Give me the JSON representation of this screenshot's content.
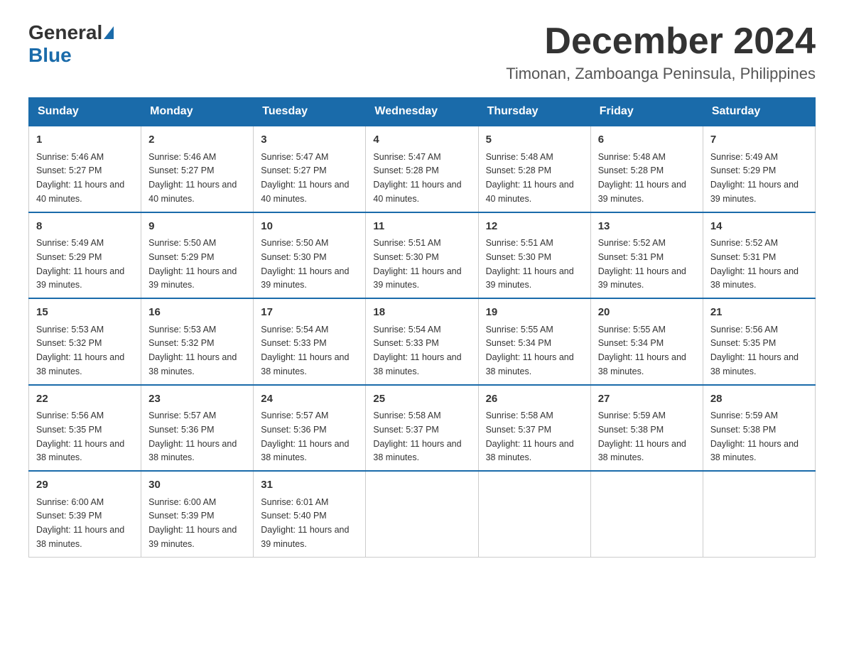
{
  "header": {
    "logo_general": "General",
    "logo_blue": "Blue",
    "month_title": "December 2024",
    "location": "Timonan, Zamboanga Peninsula, Philippines"
  },
  "days_of_week": [
    "Sunday",
    "Monday",
    "Tuesday",
    "Wednesday",
    "Thursday",
    "Friday",
    "Saturday"
  ],
  "weeks": [
    [
      {
        "day": "1",
        "sunrise": "5:46 AM",
        "sunset": "5:27 PM",
        "daylight": "11 hours and 40 minutes."
      },
      {
        "day": "2",
        "sunrise": "5:46 AM",
        "sunset": "5:27 PM",
        "daylight": "11 hours and 40 minutes."
      },
      {
        "day": "3",
        "sunrise": "5:47 AM",
        "sunset": "5:27 PM",
        "daylight": "11 hours and 40 minutes."
      },
      {
        "day": "4",
        "sunrise": "5:47 AM",
        "sunset": "5:28 PM",
        "daylight": "11 hours and 40 minutes."
      },
      {
        "day": "5",
        "sunrise": "5:48 AM",
        "sunset": "5:28 PM",
        "daylight": "11 hours and 40 minutes."
      },
      {
        "day": "6",
        "sunrise": "5:48 AM",
        "sunset": "5:28 PM",
        "daylight": "11 hours and 39 minutes."
      },
      {
        "day": "7",
        "sunrise": "5:49 AM",
        "sunset": "5:29 PM",
        "daylight": "11 hours and 39 minutes."
      }
    ],
    [
      {
        "day": "8",
        "sunrise": "5:49 AM",
        "sunset": "5:29 PM",
        "daylight": "11 hours and 39 minutes."
      },
      {
        "day": "9",
        "sunrise": "5:50 AM",
        "sunset": "5:29 PM",
        "daylight": "11 hours and 39 minutes."
      },
      {
        "day": "10",
        "sunrise": "5:50 AM",
        "sunset": "5:30 PM",
        "daylight": "11 hours and 39 minutes."
      },
      {
        "day": "11",
        "sunrise": "5:51 AM",
        "sunset": "5:30 PM",
        "daylight": "11 hours and 39 minutes."
      },
      {
        "day": "12",
        "sunrise": "5:51 AM",
        "sunset": "5:30 PM",
        "daylight": "11 hours and 39 minutes."
      },
      {
        "day": "13",
        "sunrise": "5:52 AM",
        "sunset": "5:31 PM",
        "daylight": "11 hours and 39 minutes."
      },
      {
        "day": "14",
        "sunrise": "5:52 AM",
        "sunset": "5:31 PM",
        "daylight": "11 hours and 38 minutes."
      }
    ],
    [
      {
        "day": "15",
        "sunrise": "5:53 AM",
        "sunset": "5:32 PM",
        "daylight": "11 hours and 38 minutes."
      },
      {
        "day": "16",
        "sunrise": "5:53 AM",
        "sunset": "5:32 PM",
        "daylight": "11 hours and 38 minutes."
      },
      {
        "day": "17",
        "sunrise": "5:54 AM",
        "sunset": "5:33 PM",
        "daylight": "11 hours and 38 minutes."
      },
      {
        "day": "18",
        "sunrise": "5:54 AM",
        "sunset": "5:33 PM",
        "daylight": "11 hours and 38 minutes."
      },
      {
        "day": "19",
        "sunrise": "5:55 AM",
        "sunset": "5:34 PM",
        "daylight": "11 hours and 38 minutes."
      },
      {
        "day": "20",
        "sunrise": "5:55 AM",
        "sunset": "5:34 PM",
        "daylight": "11 hours and 38 minutes."
      },
      {
        "day": "21",
        "sunrise": "5:56 AM",
        "sunset": "5:35 PM",
        "daylight": "11 hours and 38 minutes."
      }
    ],
    [
      {
        "day": "22",
        "sunrise": "5:56 AM",
        "sunset": "5:35 PM",
        "daylight": "11 hours and 38 minutes."
      },
      {
        "day": "23",
        "sunrise": "5:57 AM",
        "sunset": "5:36 PM",
        "daylight": "11 hours and 38 minutes."
      },
      {
        "day": "24",
        "sunrise": "5:57 AM",
        "sunset": "5:36 PM",
        "daylight": "11 hours and 38 minutes."
      },
      {
        "day": "25",
        "sunrise": "5:58 AM",
        "sunset": "5:37 PM",
        "daylight": "11 hours and 38 minutes."
      },
      {
        "day": "26",
        "sunrise": "5:58 AM",
        "sunset": "5:37 PM",
        "daylight": "11 hours and 38 minutes."
      },
      {
        "day": "27",
        "sunrise": "5:59 AM",
        "sunset": "5:38 PM",
        "daylight": "11 hours and 38 minutes."
      },
      {
        "day": "28",
        "sunrise": "5:59 AM",
        "sunset": "5:38 PM",
        "daylight": "11 hours and 38 minutes."
      }
    ],
    [
      {
        "day": "29",
        "sunrise": "6:00 AM",
        "sunset": "5:39 PM",
        "daylight": "11 hours and 38 minutes."
      },
      {
        "day": "30",
        "sunrise": "6:00 AM",
        "sunset": "5:39 PM",
        "daylight": "11 hours and 39 minutes."
      },
      {
        "day": "31",
        "sunrise": "6:01 AM",
        "sunset": "5:40 PM",
        "daylight": "11 hours and 39 minutes."
      },
      null,
      null,
      null,
      null
    ]
  ]
}
